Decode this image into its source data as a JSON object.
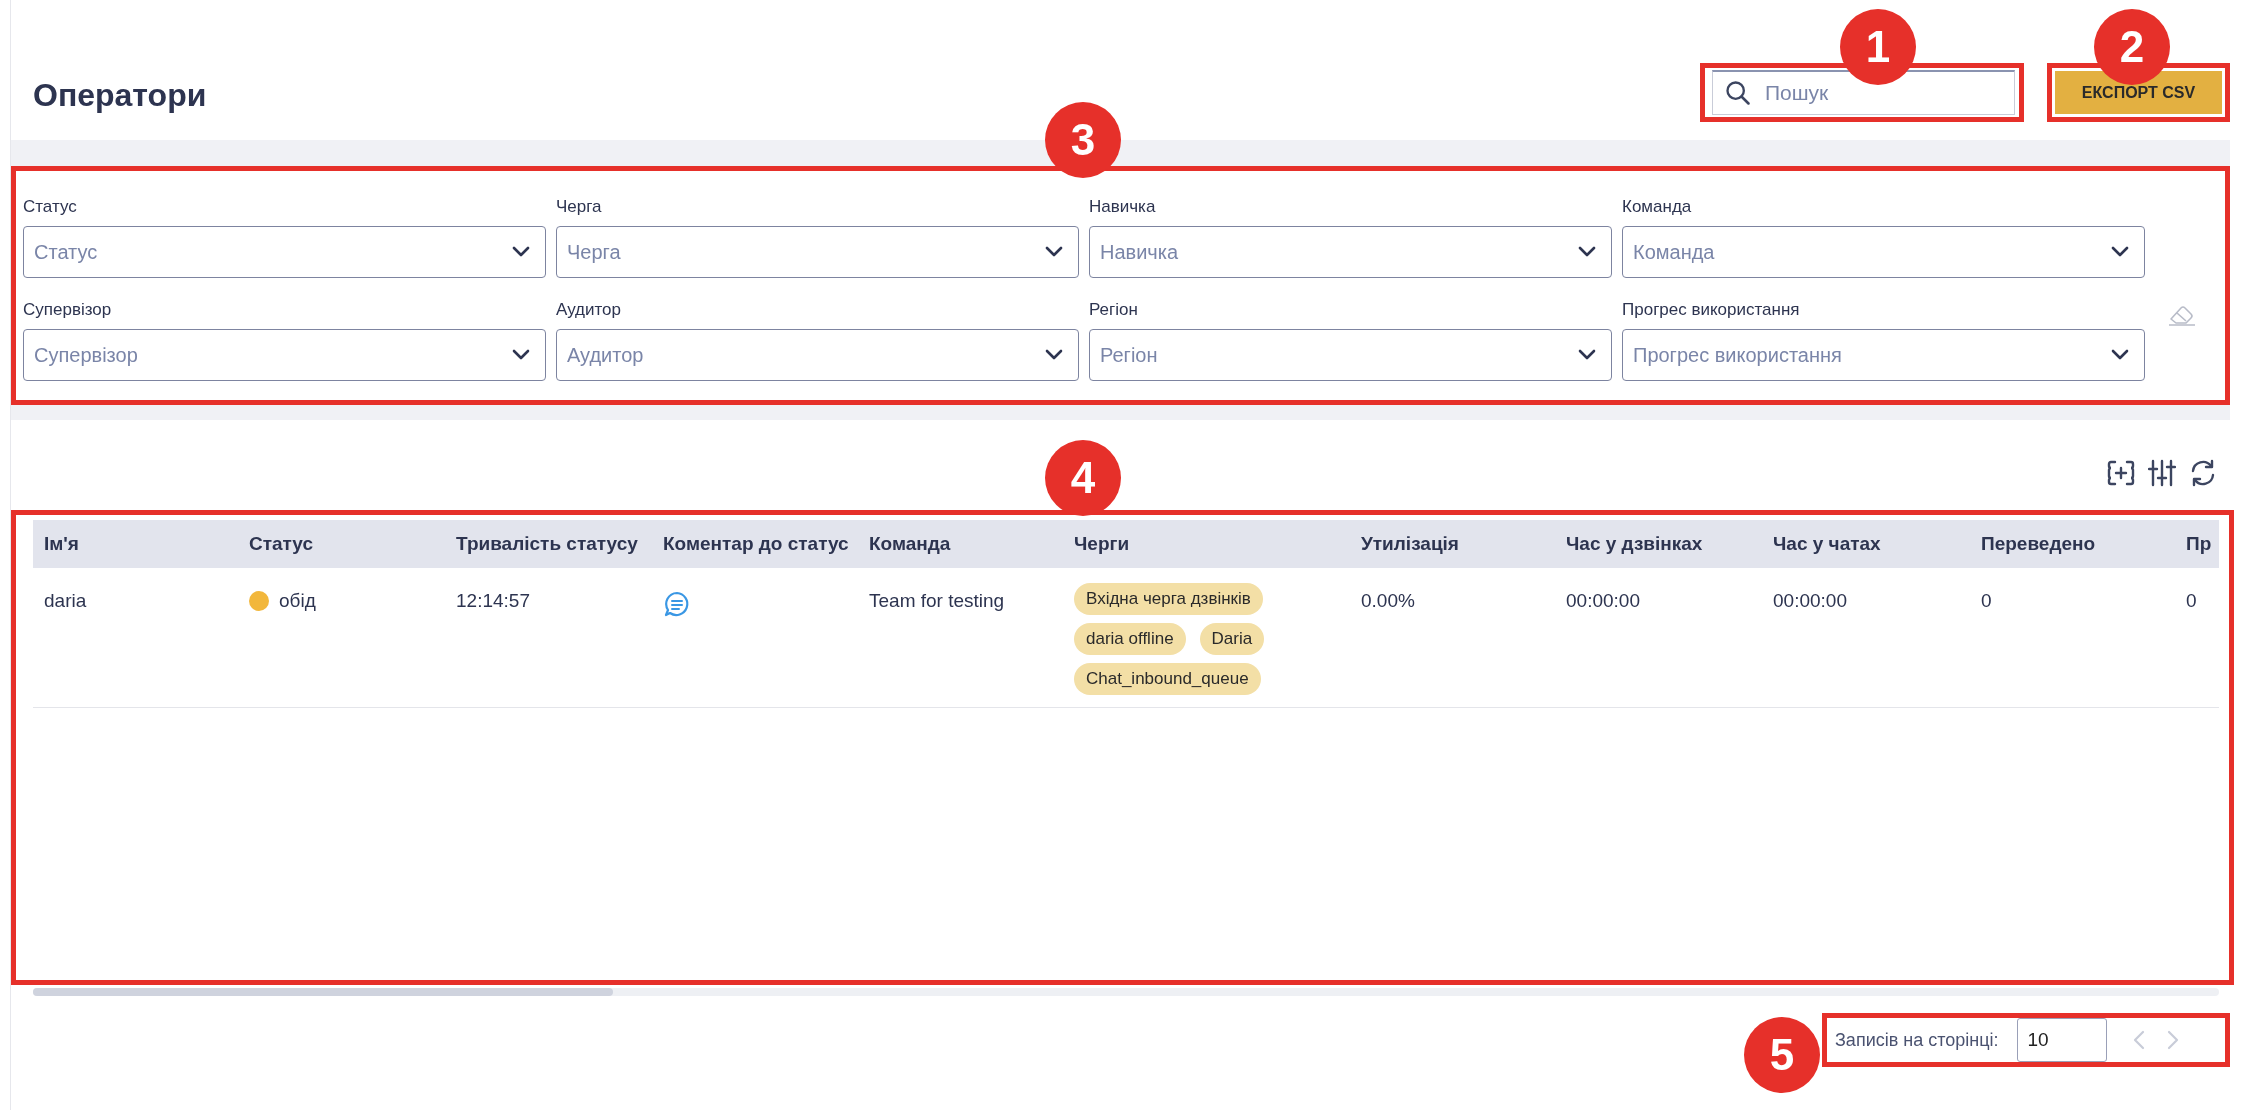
{
  "page": {
    "title": "Оператори"
  },
  "search": {
    "placeholder": "Пошук"
  },
  "export_button": "ЕКСПОРТ CSV",
  "filters": [
    {
      "label": "Статус",
      "placeholder": "Статус"
    },
    {
      "label": "Черга",
      "placeholder": "Черга"
    },
    {
      "label": "Навичка",
      "placeholder": "Навичка"
    },
    {
      "label": "Команда",
      "placeholder": "Команда"
    },
    {
      "label": "Супервізор",
      "placeholder": "Супервізор"
    },
    {
      "label": "Аудитор",
      "placeholder": "Аудитор"
    },
    {
      "label": "Регіон",
      "placeholder": "Регіон"
    },
    {
      "label": "Прогрес використання",
      "placeholder": "Прогрес використання"
    }
  ],
  "table": {
    "columns": [
      "Ім'я",
      "Статус",
      "Тривалість статусу",
      "Коментар до статус",
      "Команда",
      "Черги",
      "Утилізація",
      "Час у дзвінках",
      "Час у чатах",
      "Переведено",
      "Пр"
    ],
    "rows": [
      {
        "name": "daria",
        "status": {
          "text": "обід",
          "color": "#f2b73c"
        },
        "duration": "12:14:57",
        "has_comment": true,
        "team": "Team for testing",
        "queues": [
          "Вхідна черга дзвінків",
          "daria offline",
          "Daria",
          "Chat_inbound_queue"
        ],
        "utilization": "0.00%",
        "call_time": "00:00:00",
        "chat_time": "00:00:00",
        "transferred": "0",
        "column_11": "0"
      }
    ]
  },
  "pagination": {
    "label": "Записів на сторінці:",
    "value": "10",
    "prev_disabled": true,
    "next_disabled": true
  },
  "annotations": [
    {
      "label": "1"
    },
    {
      "label": "2"
    },
    {
      "label": "3"
    },
    {
      "label": "4"
    },
    {
      "label": "5"
    }
  ]
}
